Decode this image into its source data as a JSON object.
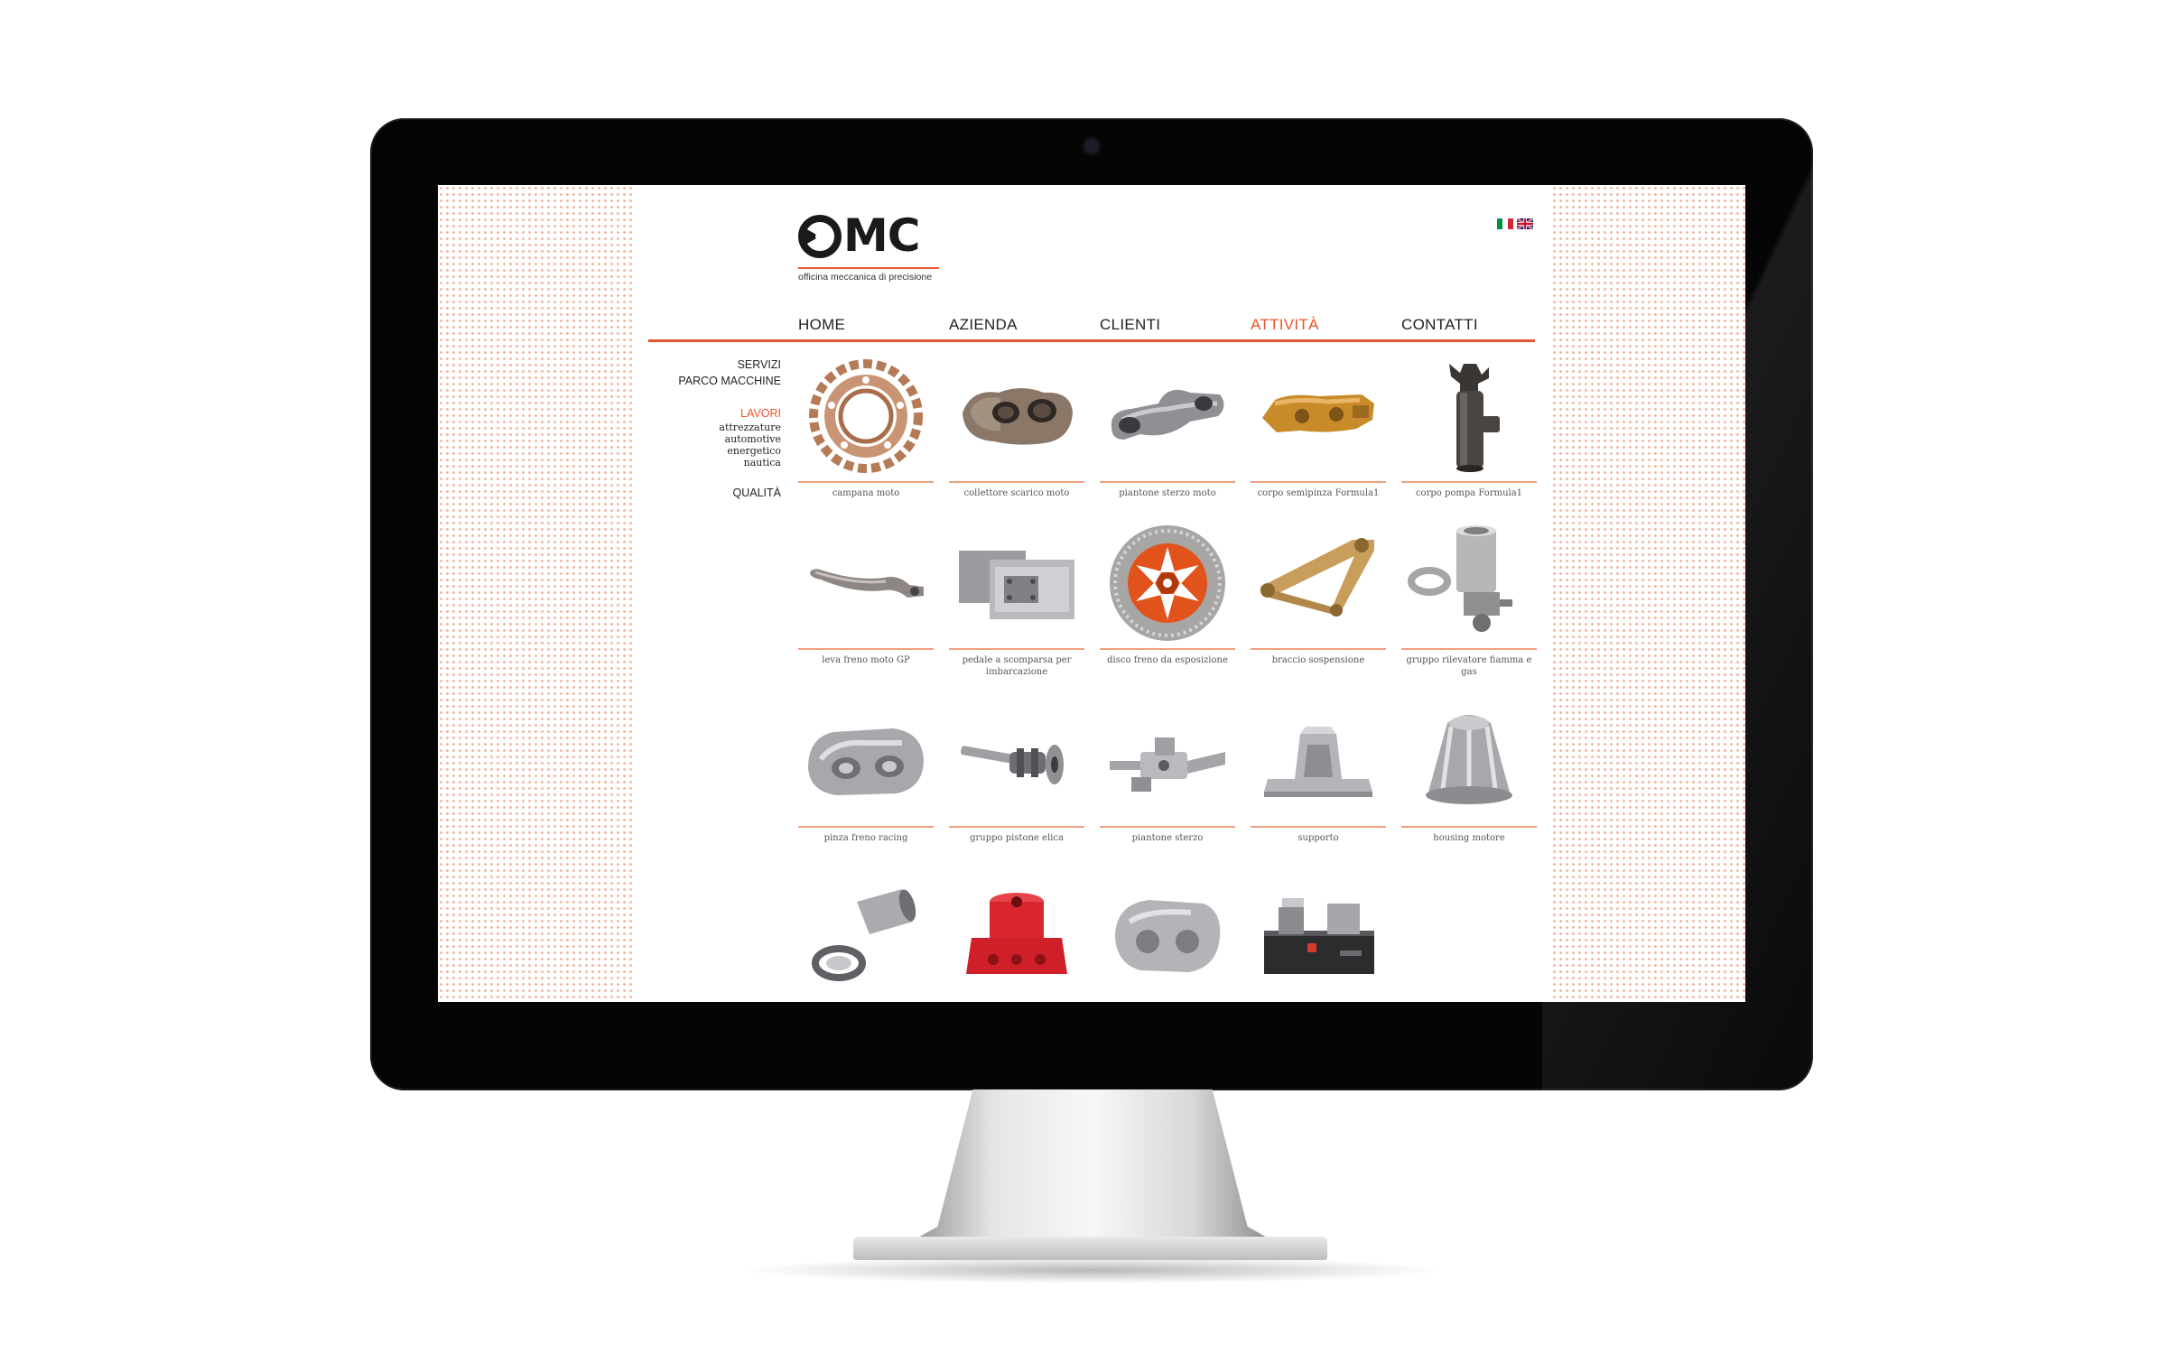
{
  "brand": {
    "name": "MC",
    "tagline": "officina meccanica di precisione",
    "accent": "#e8552a"
  },
  "languages": [
    {
      "code": "it",
      "icon": "italy-flag-icon"
    },
    {
      "code": "en",
      "icon": "uk-flag-icon"
    }
  ],
  "nav": [
    {
      "label": "HOME",
      "active": false
    },
    {
      "label": "AZIENDA",
      "active": false
    },
    {
      "label": "CLIENTI",
      "active": false
    },
    {
      "label": "ATTIVITÀ",
      "active": true
    },
    {
      "label": "CONTATTI",
      "active": false
    }
  ],
  "sidebar": {
    "servizi": "SERVIZI",
    "parco": "PARCO MACCHINE",
    "lavori": "LAVORI",
    "lavori_sub": [
      "attrezzature",
      "automotive",
      "energetico",
      "nautica"
    ],
    "qualita": "QUALITÀ"
  },
  "products": [
    [
      {
        "caption": "campana moto",
        "icon": "brake-disc-carrier-icon"
      },
      {
        "caption": "collettore scarico moto",
        "icon": "exhaust-manifold-icon"
      },
      {
        "caption": "piantone sterzo moto",
        "icon": "steering-clamp-icon"
      },
      {
        "caption": "corpo semipinza Formula1",
        "icon": "caliper-half-icon"
      },
      {
        "caption": "corpo pompa Formula1",
        "icon": "pump-body-icon"
      }
    ],
    [
      {
        "caption": "leva freno moto GP",
        "icon": "brake-lever-icon"
      },
      {
        "caption": "pedale a scomparsa per imbarcazione",
        "icon": "retractable-pedal-icon"
      },
      {
        "caption": "disco freno da esposizione",
        "icon": "display-brake-disc-icon"
      },
      {
        "caption": "braccio sospensione",
        "icon": "suspension-arm-icon"
      },
      {
        "caption": "gruppo rilevatore fiamma e gas",
        "icon": "flame-detector-icon"
      }
    ],
    [
      {
        "caption": "pinza freno racing",
        "icon": "racing-caliper-icon"
      },
      {
        "caption": "gruppo pistone elica",
        "icon": "propeller-piston-icon"
      },
      {
        "caption": "piantone sterzo",
        "icon": "steering-column-icon"
      },
      {
        "caption": "supporto",
        "icon": "support-bracket-icon"
      },
      {
        "caption": "housing motore",
        "icon": "motor-housing-icon"
      }
    ],
    [
      {
        "caption": "",
        "icon": "cylinder-part-icon"
      },
      {
        "caption": "",
        "icon": "red-block-icon"
      },
      {
        "caption": "",
        "icon": "brake-caliper-icon"
      },
      {
        "caption": "",
        "icon": "assembly-fixture-icon"
      }
    ]
  ]
}
